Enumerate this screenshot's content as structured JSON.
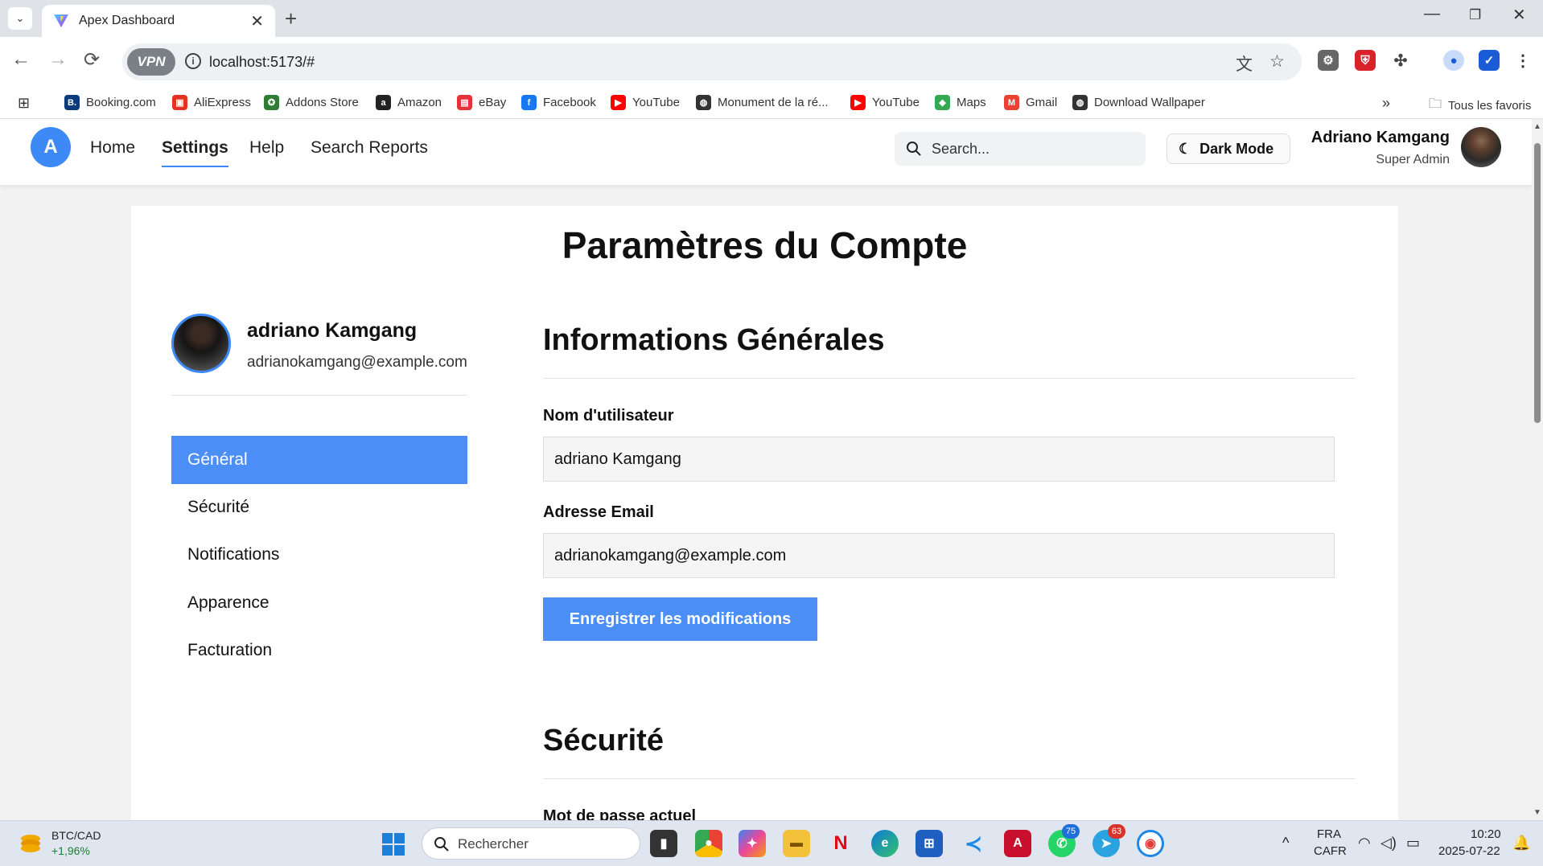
{
  "browser": {
    "tab_title": "Apex Dashboard",
    "url": "localhost:5173/#",
    "vpn_label": "VPN",
    "bookmarks": [
      {
        "label": "Booking.com",
        "icon": "booking-icon",
        "color": "#0c3b7c"
      },
      {
        "label": "AliExpress",
        "icon": "aliexpress-icon",
        "color": "#e43225"
      },
      {
        "label": "Addons Store",
        "icon": "addons-store-icon",
        "color": "#2f7d32"
      },
      {
        "label": "Amazon",
        "icon": "amazon-icon",
        "color": "#222222"
      },
      {
        "label": "eBay",
        "icon": "ebay-icon",
        "color": "#e53238"
      },
      {
        "label": "Facebook",
        "icon": "facebook-icon",
        "color": "#1877f2"
      },
      {
        "label": "YouTube",
        "icon": "youtube-icon",
        "color": "#ff0000"
      },
      {
        "label": "Monument de la ré...",
        "icon": "globe-icon",
        "color": "#333333"
      },
      {
        "label": "YouTube",
        "icon": "youtube-icon",
        "color": "#ff0000"
      },
      {
        "label": "Maps",
        "icon": "maps-icon",
        "color": "#34a853"
      },
      {
        "label": "Gmail",
        "icon": "gmail-icon",
        "color": "#ea4335"
      },
      {
        "label": "Download Wallpaper",
        "icon": "globe-icon",
        "color": "#333333"
      }
    ],
    "all_bookmarks_label": "Tous les favoris"
  },
  "app": {
    "logo_letter": "A",
    "nav": [
      {
        "label": "Home",
        "active": false
      },
      {
        "label": "Settings",
        "active": true
      },
      {
        "label": "Help",
        "active": false
      },
      {
        "label": "Search Reports",
        "active": false
      }
    ],
    "search_placeholder": "Search...",
    "dark_mode_label": "Dark Mode",
    "user_name": "Adriano Kamgang",
    "user_role": "Super Admin",
    "accent_color": "#4a8ef6"
  },
  "settings": {
    "page_title": "Paramètres du Compte",
    "profile": {
      "name": "adriano Kamgang",
      "email": "adrianokamgang@example.com"
    },
    "sidebar": [
      {
        "label": "Général",
        "active": true
      },
      {
        "label": "Sécurité",
        "active": false
      },
      {
        "label": "Notifications",
        "active": false
      },
      {
        "label": "Apparence",
        "active": false
      },
      {
        "label": "Facturation",
        "active": false
      }
    ],
    "general": {
      "heading": "Informations Générales",
      "username_label": "Nom d'utilisateur",
      "username_value": "adriano Kamgang",
      "email_label": "Adresse Email",
      "email_value": "adrianokamgang@example.com",
      "save_label": "Enregistrer les modifications"
    },
    "security": {
      "heading": "Sécurité",
      "current_password_label": "Mot de passe actuel"
    }
  },
  "taskbar": {
    "ticker": "BTC/CAD",
    "ticker_change": "+1,96%",
    "search_placeholder": "Rechercher",
    "badges": {
      "whatsapp": "75",
      "telegram": "63"
    },
    "lang_top": "FRA",
    "lang_bottom": "CAFR",
    "time": "10:20",
    "date": "2025-07-22"
  }
}
